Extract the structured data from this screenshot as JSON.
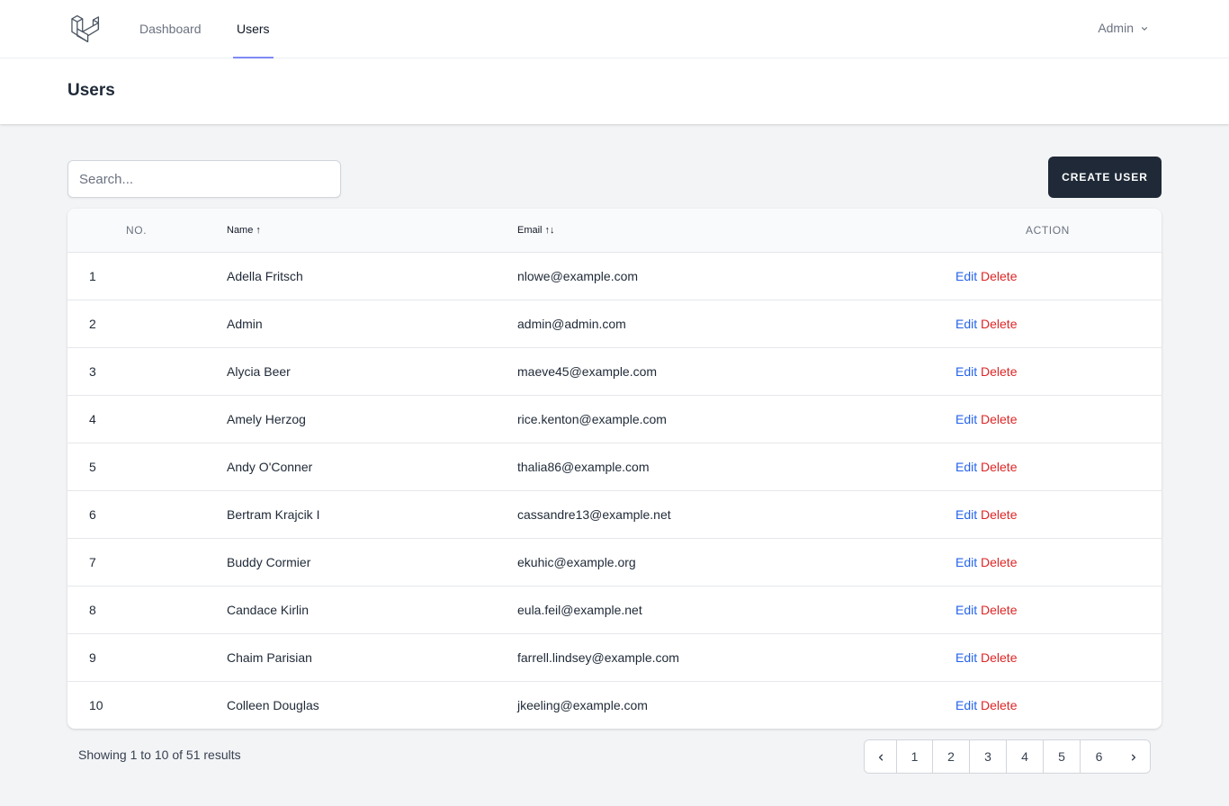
{
  "nav": {
    "items": [
      {
        "label": "Dashboard",
        "active": false
      },
      {
        "label": "Users",
        "active": true
      }
    ],
    "user_menu": "Admin"
  },
  "header": {
    "title": "Users"
  },
  "toolbar": {
    "search_placeholder": "Search...",
    "create_label": "CREATE USER"
  },
  "table": {
    "columns": {
      "no": "NO.",
      "name": "Name ↑",
      "email": "Email ↑↓",
      "action": "ACTION"
    },
    "edit_label": "Edit",
    "delete_label": "Delete",
    "rows": [
      {
        "no": "1",
        "name": "Adella Fritsch",
        "email": "nlowe@example.com"
      },
      {
        "no": "2",
        "name": "Admin",
        "email": "admin@admin.com"
      },
      {
        "no": "3",
        "name": "Alycia Beer",
        "email": "maeve45@example.com"
      },
      {
        "no": "4",
        "name": "Amely Herzog",
        "email": "rice.kenton@example.com"
      },
      {
        "no": "5",
        "name": "Andy O'Conner",
        "email": "thalia86@example.com"
      },
      {
        "no": "6",
        "name": "Bertram Krajcik I",
        "email": "cassandre13@example.net"
      },
      {
        "no": "7",
        "name": "Buddy Cormier",
        "email": "ekuhic@example.org"
      },
      {
        "no": "8",
        "name": "Candace Kirlin",
        "email": "eula.feil@example.net"
      },
      {
        "no": "9",
        "name": "Chaim Parisian",
        "email": "farrell.lindsey@example.com"
      },
      {
        "no": "10",
        "name": "Colleen Douglas",
        "email": "jkeeling@example.com"
      }
    ]
  },
  "pagination": {
    "showing_prefix": "Showing",
    "from": "1",
    "to_word": "to",
    "to": "10",
    "of_word": "of",
    "total": "51",
    "results_word": "results",
    "pages": [
      "1",
      "2",
      "3",
      "4",
      "5",
      "6"
    ]
  },
  "colors": {
    "accent_underline": "#818cf8",
    "primary_button": "#1f2937",
    "edit_link": "#2563eb",
    "delete_link": "#dc2626"
  }
}
